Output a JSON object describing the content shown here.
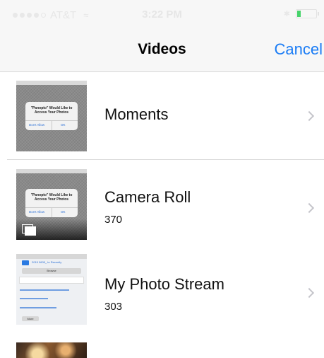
{
  "status_bar": {
    "carrier": "AT&T",
    "time": "3:22 PM",
    "battery_level": 0.2,
    "battery_color": "#46d36a"
  },
  "nav": {
    "title": "Videos",
    "cancel_label": "Cancel",
    "accent_color": "#1a7cf5"
  },
  "albums": [
    {
      "name": "Moments",
      "count": "",
      "thumbnail": {
        "alert_title": "\"Panopto\" Would Like to Access Your Photos",
        "dont_allow": "Don't Allow",
        "ok": "OK"
      }
    },
    {
      "name": "Camera Roll",
      "count": "370",
      "thumbnail": {
        "alert_title": "\"Panopto\" Would Like to Access Your Photos",
        "dont_allow": "Don't Allow",
        "ok": "OK"
      }
    },
    {
      "name": "My Photo Stream",
      "count": "303",
      "thumbnail": {
        "header": "2015 0605_ to Recently",
        "browse": "Browse",
        "more": "More"
      }
    }
  ]
}
